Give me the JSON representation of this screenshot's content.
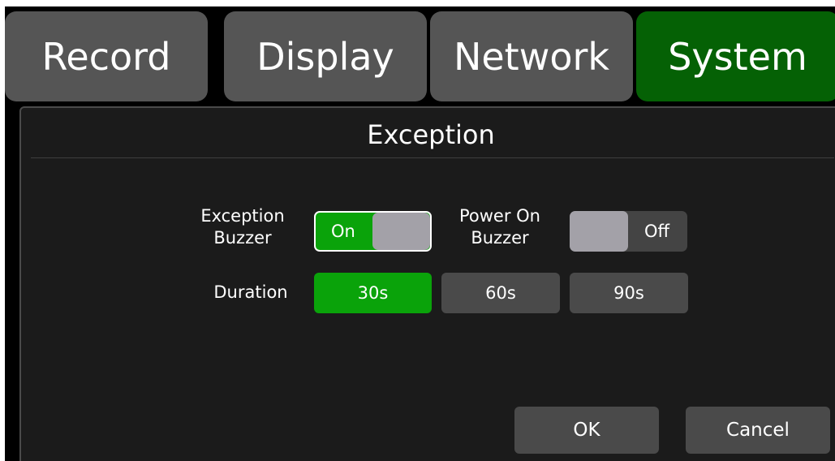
{
  "tabs": [
    {
      "label": "Record",
      "active": false
    },
    {
      "label": "Display",
      "active": false
    },
    {
      "label": "Network",
      "active": false
    },
    {
      "label": "System",
      "active": true
    }
  ],
  "panel": {
    "title": "Exception",
    "exception_buzzer": {
      "label_line1": "Exception",
      "label_line2": "Buzzer",
      "state_label": "On",
      "enabled": true
    },
    "power_on_buzzer": {
      "label_line1": "Power On",
      "label_line2": "Buzzer",
      "state_label": "Off",
      "enabled": false
    },
    "duration": {
      "label": "Duration",
      "options": [
        "30s",
        "60s",
        "90s"
      ],
      "selected": "30s"
    },
    "ok_label": "OK",
    "cancel_label": "Cancel"
  },
  "colors": {
    "active_tab": "#056105",
    "tab": "#555555",
    "selected": "#0aa30a",
    "button": "#4a4a4a",
    "knob": "#a3a1a8",
    "panel": "#1b1b1b"
  }
}
